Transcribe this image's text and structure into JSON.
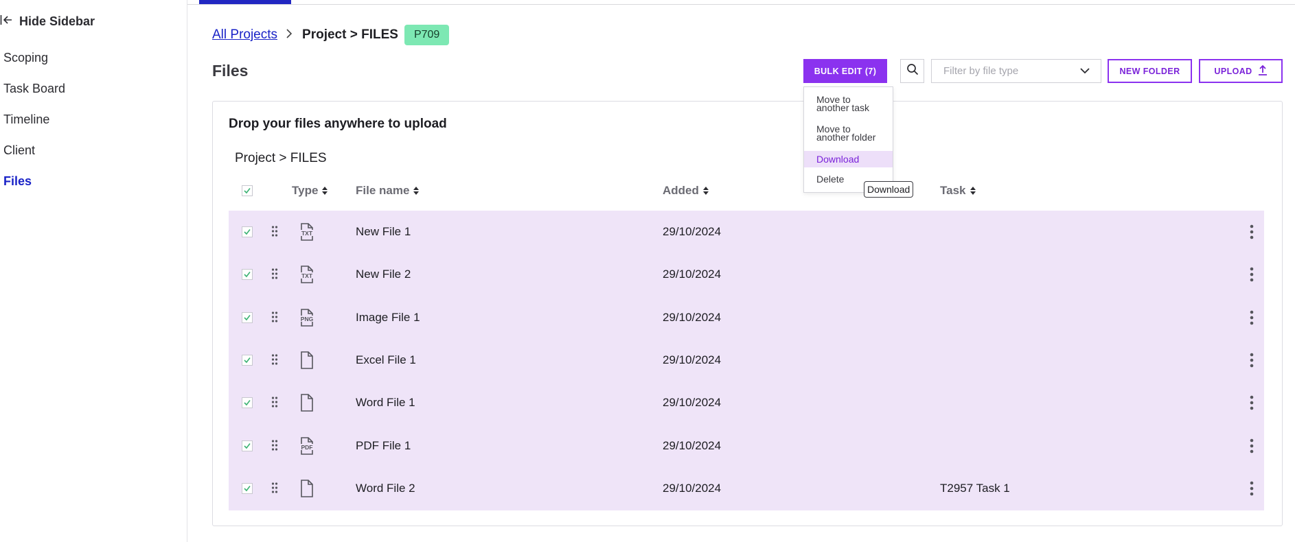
{
  "sidebar": {
    "hide_label": "Hide Sidebar",
    "items": [
      {
        "label": "Scoping"
      },
      {
        "label": "Task Board"
      },
      {
        "label": "Timeline"
      },
      {
        "label": "Client"
      },
      {
        "label": "Files",
        "active": true
      }
    ]
  },
  "breadcrumb": {
    "root": "All Projects",
    "current": "Project > FILES",
    "badge": "P709"
  },
  "page": {
    "title": "Files"
  },
  "toolbar": {
    "bulk_edit": "BULK EDIT (7)",
    "filter_placeholder": "Filter by file type",
    "new_folder": "NEW FOLDER",
    "upload": "UPLOAD"
  },
  "bulk_menu": {
    "items": [
      {
        "line1": "Move to",
        "line2": "another task"
      },
      {
        "line1": "Move to",
        "line2": "another folder"
      },
      {
        "line1": "Download",
        "highlighted": true
      },
      {
        "line1": "Delete"
      }
    ],
    "tooltip": "Download"
  },
  "panel": {
    "drop_title": "Drop your files anywhere to upload",
    "path": "Project > FILES"
  },
  "table": {
    "columns": {
      "type": "Type",
      "name": "File name",
      "added": "Added",
      "task": "Task"
    },
    "rows": [
      {
        "icon": "txt-file-icon",
        "name": "New File 1",
        "added": "29/10/2024",
        "task": "",
        "checked": true
      },
      {
        "icon": "txt-file-icon",
        "name": "New File 2",
        "added": "29/10/2024",
        "task": "",
        "checked": true
      },
      {
        "icon": "png-file-icon",
        "name": "Image File 1",
        "added": "29/10/2024",
        "task": "",
        "checked": true
      },
      {
        "icon": "blank-file-icon",
        "name": "Excel File 1",
        "added": "29/10/2024",
        "task": "",
        "checked": true
      },
      {
        "icon": "blank-file-icon",
        "name": "Word File 1",
        "added": "29/10/2024",
        "task": "",
        "checked": true
      },
      {
        "icon": "pdf-file-icon",
        "name": "PDF File 1",
        "added": "29/10/2024",
        "task": "",
        "checked": true
      },
      {
        "icon": "blank-file-icon",
        "name": "Word File 2",
        "added": "29/10/2024",
        "task": "T2957 Task 1",
        "checked": true
      }
    ]
  },
  "colors": {
    "accent": "#8b32ef",
    "link": "#1a23c7",
    "badge_bg": "#7de8b3",
    "selected_row_bg": "#efe4f8",
    "check": "#3bb273"
  }
}
